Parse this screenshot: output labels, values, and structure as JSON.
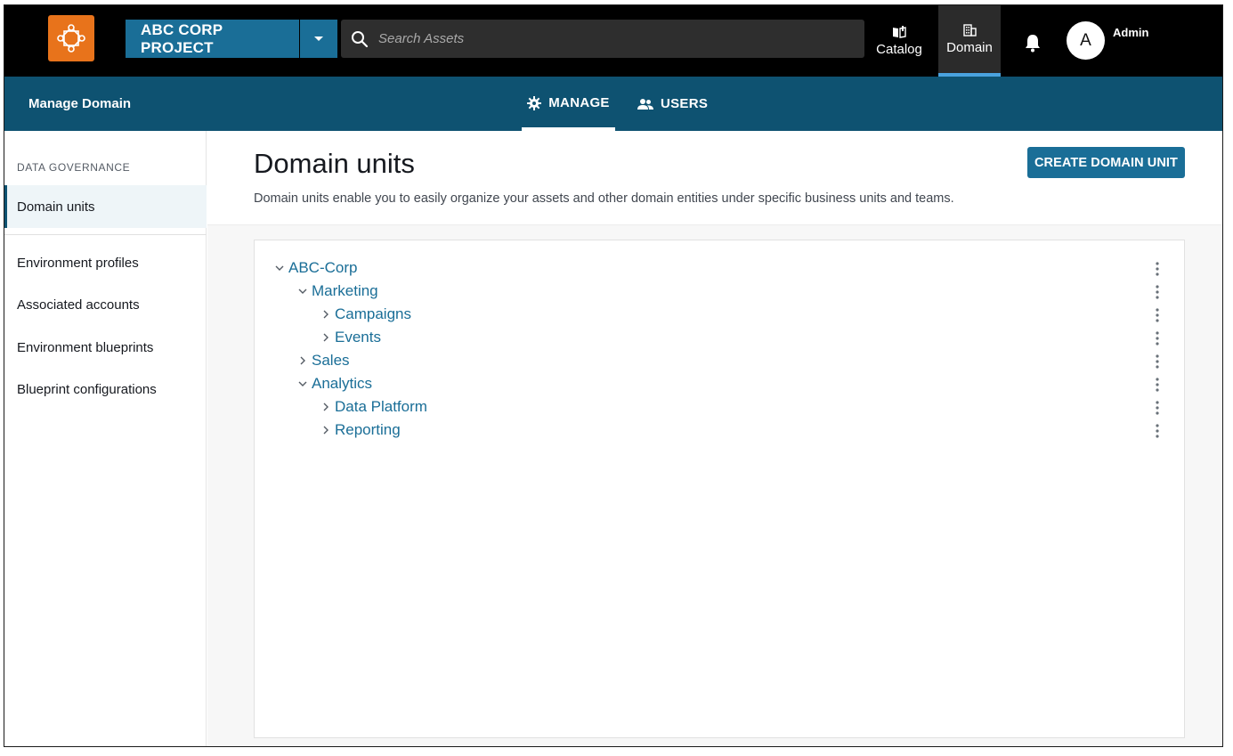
{
  "header": {
    "project_label": "ABC CORP PROJECT",
    "search_placeholder": "Search Assets",
    "nav": [
      {
        "label": "Catalog",
        "icon": "book-icon"
      },
      {
        "label": "Domain",
        "icon": "building-icon",
        "active": true
      }
    ],
    "avatar_initial": "A",
    "user_label": "Admin"
  },
  "subheader": {
    "title": "Manage Domain",
    "tabs": [
      {
        "label": "MANAGE",
        "icon": "gear-icon",
        "active": true
      },
      {
        "label": "USERS",
        "icon": "users-icon"
      }
    ]
  },
  "sidebar": {
    "section_label": "DATA GOVERNANCE",
    "active_item": "Domain units",
    "items": [
      "Environment profiles",
      "Associated accounts",
      "Environment blueprints",
      "Blueprint configurations"
    ]
  },
  "main": {
    "title": "Domain units",
    "description": "Domain units enable you to easily organize your assets and other domain entities under specific business units and teams.",
    "create_button": "CREATE DOMAIN UNIT",
    "tree": [
      {
        "label": "ABC-Corp",
        "depth": 0,
        "expanded": true
      },
      {
        "label": "Marketing",
        "depth": 1,
        "expanded": true
      },
      {
        "label": "Campaigns",
        "depth": 2,
        "expanded": false
      },
      {
        "label": "Events",
        "depth": 2,
        "expanded": false
      },
      {
        "label": "Sales",
        "depth": 1,
        "expanded": false
      },
      {
        "label": "Analytics",
        "depth": 1,
        "expanded": true
      },
      {
        "label": "Data Platform",
        "depth": 2,
        "expanded": false
      },
      {
        "label": "Reporting",
        "depth": 2,
        "expanded": false
      }
    ]
  },
  "colors": {
    "topbar": "#000000",
    "accent": "#1a6e97",
    "subheader": "#0e5271",
    "logo": "#e8731b"
  }
}
